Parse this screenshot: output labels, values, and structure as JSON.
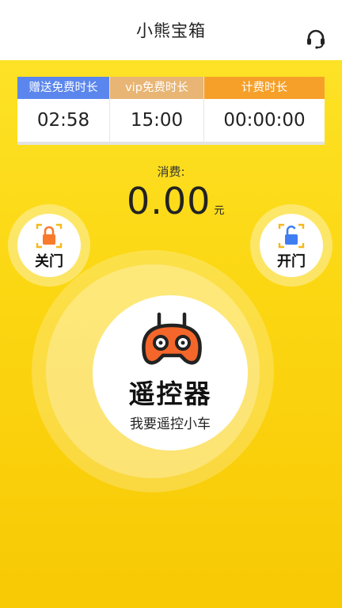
{
  "header": {
    "title": "小熊宝箱",
    "service_icon": "headset-icon"
  },
  "timers": [
    {
      "label": "赠送免费时长",
      "value": "02:58",
      "color": "#5b86ed"
    },
    {
      "label": "vip免费时长",
      "value": "15:00",
      "color": "#e8b574"
    },
    {
      "label": "计费时长",
      "value": "00:00:00",
      "color": "#f6a02a"
    }
  ],
  "fee": {
    "label": "消费:",
    "amount": "0.00",
    "unit": "元"
  },
  "lock": {
    "close_label": "关门",
    "close_icon": "lock-closed-icon",
    "close_color": "#f97a2b",
    "open_label": "开门",
    "open_icon": "lock-open-icon",
    "open_color": "#3f7ef2"
  },
  "remote": {
    "title": "遥控器",
    "subtitle": "我要遥控小车",
    "icon": "remote-controller-icon",
    "icon_color": "#f4662a"
  },
  "colors": {
    "background_top": "#fde226",
    "background_bottom": "#f8c905"
  }
}
